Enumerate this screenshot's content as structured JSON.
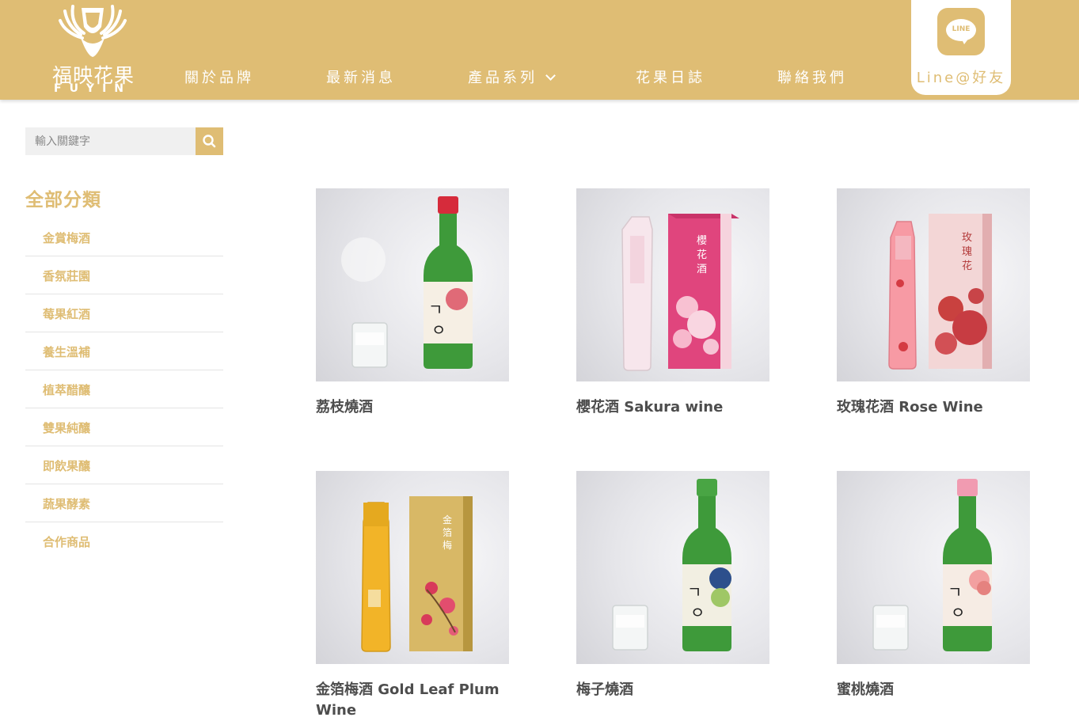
{
  "header": {
    "logo_text_zh": "福映花果",
    "logo_text_en": "FUYIN",
    "nav": [
      {
        "label": "關於品牌"
      },
      {
        "label": "最新消息"
      },
      {
        "label": "產品系列"
      },
      {
        "label": "花果日誌"
      },
      {
        "label": "聯絡我們"
      }
    ],
    "line_icon_text": "LINE",
    "line_label": "Line@好友"
  },
  "search": {
    "placeholder": "輸入關鍵字"
  },
  "sidebar": {
    "title": "全部分類",
    "categories": [
      {
        "label": "金賞梅酒"
      },
      {
        "label": "香氛莊園"
      },
      {
        "label": "莓果紅酒"
      },
      {
        "label": "養生溫補"
      },
      {
        "label": "植萃醋釀"
      },
      {
        "label": "雙果純釀"
      },
      {
        "label": "即飲果釀"
      },
      {
        "label": "蔬果酵素"
      },
      {
        "label": "合作商品"
      }
    ]
  },
  "products": [
    {
      "name": "荔枝燒酒"
    },
    {
      "name": "櫻花酒 Sakura wine"
    },
    {
      "name": "玫瑰花酒 Rose Wine"
    },
    {
      "name": "金箔梅酒 Gold Leaf Plum Wine"
    },
    {
      "name": "梅子燒酒"
    },
    {
      "name": "蜜桃燒酒"
    }
  ],
  "colors": {
    "brand": "#dfbd74",
    "text": "#4d4d4d"
  }
}
